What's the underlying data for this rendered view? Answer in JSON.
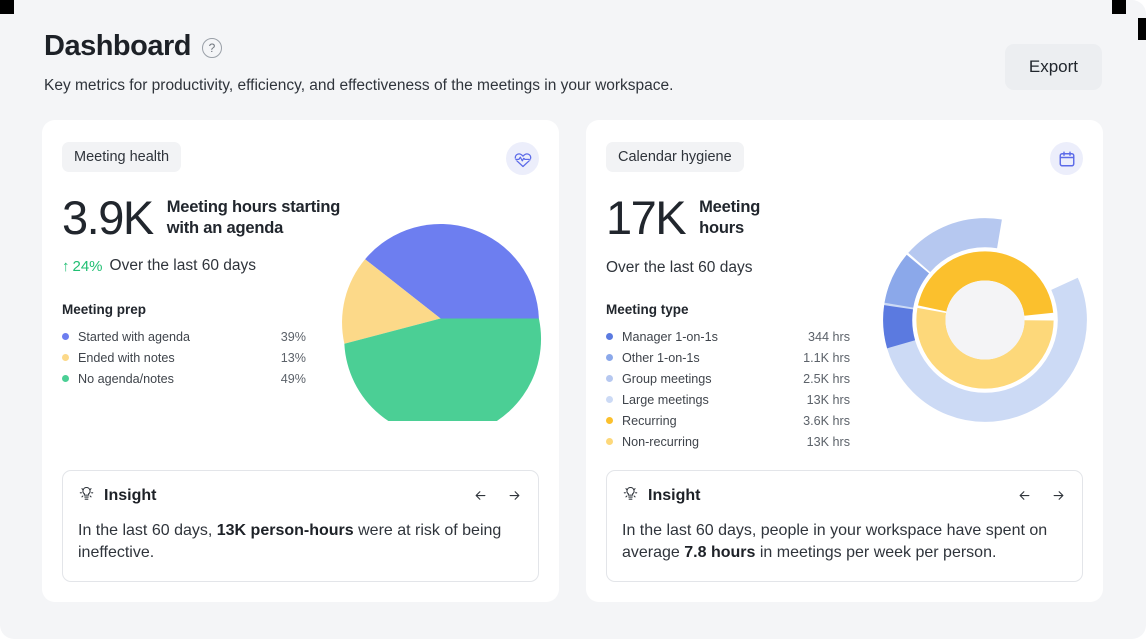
{
  "header": {
    "title": "Dashboard",
    "help_icon": "question-mark-icon",
    "subtitle": "Key metrics for productivity, efficiency, and effectiveness of the meetings in your workspace.",
    "export_label": "Export"
  },
  "cards": [
    {
      "pill": "Meeting health",
      "icon": "heart-pulse-icon",
      "metric_value": "3.9K",
      "metric_label": "Meeting hours starting with an agenda",
      "delta_arrow": "↑",
      "delta_value": "24%",
      "delta_context": "Over the last 60 days",
      "legend_title": "Meeting prep",
      "insight": {
        "icon": "lightbulb-icon",
        "title": "Insight",
        "prev_arrow": "←",
        "next_arrow": "→",
        "text_before": "In the last 60 days, ",
        "text_bold": "13K person-hours",
        "text_after": " were at risk of being ineffective."
      }
    },
    {
      "pill": "Calendar hygiene",
      "icon": "calendar-icon",
      "metric_value": "17K",
      "metric_label": "Meeting hours",
      "delta_context": "Over the last 60 days",
      "legend_title": "Meeting type",
      "insight": {
        "icon": "lightbulb-icon",
        "title": "Insight",
        "prev_arrow": "←",
        "next_arrow": "→",
        "text_before": "In the last 60 days, people in your workspace have spent on average ",
        "text_bold": "7.8 hours",
        "text_after": " in meetings per week per person."
      }
    }
  ],
  "chart_data": [
    {
      "type": "pie",
      "title": "Meeting prep",
      "categories": [
        "Started with agenda",
        "Ended with notes",
        "No agenda/notes"
      ],
      "values": [
        39,
        13,
        49
      ],
      "value_labels": [
        "39%",
        "13%",
        "49%"
      ],
      "colors": [
        "#6d7ef0",
        "#fcd989",
        "#4bcf95"
      ],
      "unit": "percent",
      "legend_position": "left",
      "grid": false
    },
    {
      "type": "pie",
      "title": "Meeting type",
      "subtype": "nested-donut",
      "rings": [
        {
          "name": "outer",
          "categories": [
            "Manager 1-on-1s",
            "Other 1-on-1s",
            "Group meetings",
            "Large meetings"
          ],
          "values": [
            344,
            1100,
            2500,
            13000
          ],
          "value_labels": [
            "344 hrs",
            "1.1K hrs",
            "2.5K hrs",
            "13K hrs"
          ],
          "colors": [
            "#5b7ae0",
            "#96b2ec",
            "#bfd0f2",
            "#ccdaf5"
          ]
        },
        {
          "name": "inner",
          "categories": [
            "Recurring",
            "Non-recurring"
          ],
          "values": [
            3600,
            13000
          ],
          "value_labels": [
            "3.6K hrs",
            "13K hrs"
          ],
          "colors": [
            "#fbc02d",
            "#fdd87a"
          ]
        }
      ],
      "unit": "hours",
      "legend_position": "left",
      "grid": false
    }
  ],
  "legends": {
    "card1": [
      {
        "label": "Started with agenda",
        "value": "39%",
        "color": "#6d7ef0"
      },
      {
        "label": "Ended with notes",
        "value": "13%",
        "color": "#fcd989"
      },
      {
        "label": "No agenda/notes",
        "value": "49%",
        "color": "#4bcf95"
      }
    ],
    "card2": [
      {
        "label": "Manager 1-on-1s",
        "value": "344 hrs",
        "color": "#5b7ae0"
      },
      {
        "label": "Other 1-on-1s",
        "value": "1.1K hrs",
        "color": "#8ba8ea"
      },
      {
        "label": "Group meetings",
        "value": "2.5K hrs",
        "color": "#b6c8f0"
      },
      {
        "label": "Large meetings",
        "value": "13K hrs",
        "color": "#ccdaf5"
      },
      {
        "label": "Recurring",
        "value": "3.6K hrs",
        "color": "#fbc02d"
      },
      {
        "label": "Non-recurring",
        "value": "13K hrs",
        "color": "#fdd87a"
      }
    ]
  }
}
